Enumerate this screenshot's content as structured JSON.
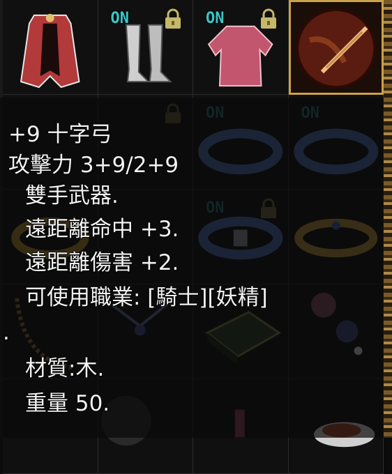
{
  "inventory": {
    "slots": [
      {
        "item": "red-cloak",
        "on": false,
        "locked": false,
        "selected": false
      },
      {
        "item": "silver-boots",
        "on": true,
        "locked": true,
        "selected": false
      },
      {
        "item": "red-tunic",
        "on": true,
        "locked": true,
        "selected": false
      },
      {
        "item": "crossbow",
        "on": false,
        "locked": false,
        "selected": true
      },
      {
        "item": "empty",
        "on": false,
        "locked": false,
        "selected": false
      },
      {
        "item": "empty",
        "on": false,
        "locked": true,
        "selected": false
      },
      {
        "item": "blue-ring",
        "on": true,
        "locked": false,
        "selected": false
      },
      {
        "item": "blue-ring",
        "on": true,
        "locked": false,
        "selected": false
      },
      {
        "item": "gold-ring",
        "on": false,
        "locked": false,
        "selected": false
      },
      {
        "item": "empty",
        "on": false,
        "locked": false,
        "selected": false
      },
      {
        "item": "blue-belt-ring",
        "on": true,
        "locked": true,
        "selected": false
      },
      {
        "item": "gold-ring",
        "on": false,
        "locked": false,
        "selected": false
      },
      {
        "item": "gold-necklace",
        "on": false,
        "locked": false,
        "selected": false
      },
      {
        "item": "blue-amulet",
        "on": false,
        "locked": false,
        "selected": false
      },
      {
        "item": "green-book",
        "on": false,
        "locked": false,
        "selected": false
      },
      {
        "item": "flower-ornament",
        "on": false,
        "locked": false,
        "selected": false
      },
      {
        "item": "empty",
        "on": false,
        "locked": false,
        "selected": false
      },
      {
        "item": "pearl",
        "on": false,
        "locked": false,
        "selected": false
      },
      {
        "item": "potion",
        "on": false,
        "locked": false,
        "selected": false
      },
      {
        "item": "food-plate",
        "on": false,
        "locked": false,
        "selected": false
      }
    ],
    "on_label": "ON",
    "icons": [
      "lock-icon"
    ]
  },
  "tooltip": {
    "name": "+9 十字弓",
    "attack": "攻擊力 3+9/2+9",
    "hands": "雙手武器.",
    "ranged_hit": "遠距離命中 +3.",
    "ranged_damage": "遠距離傷害 +2.",
    "classes": "可使用職業: [騎士][妖精]",
    "dot": ".",
    "material": "材質:木.",
    "weight": "重量 50."
  },
  "colors": {
    "on_badge": "#39c7c7",
    "selected_border": "#c9a24a",
    "tooltip_text": "#f2f2f2"
  }
}
